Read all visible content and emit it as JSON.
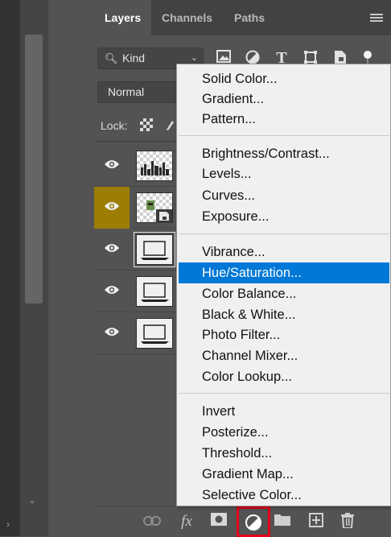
{
  "tabs": [
    {
      "label": "Layers",
      "active": true
    },
    {
      "label": "Channels",
      "active": false
    },
    {
      "label": "Paths",
      "active": false
    }
  ],
  "filter": {
    "kind_label": "Kind"
  },
  "blend_mode": "Normal",
  "lock_label": "Lock:",
  "layers": [
    {
      "thumb": "city-silhouette",
      "visible": true,
      "highlighted": false
    },
    {
      "thumb": "smart-object-image",
      "visible": true,
      "highlighted": true
    },
    {
      "thumb": "laptop-image",
      "visible": true,
      "highlighted": false,
      "selected": true
    },
    {
      "thumb": "laptop-image",
      "visible": true,
      "highlighted": false
    },
    {
      "thumb": "laptop-image",
      "visible": true,
      "highlighted": false
    }
  ],
  "adjustment_menu": {
    "groups": [
      [
        "Solid Color...",
        "Gradient...",
        "Pattern..."
      ],
      [
        "Brightness/Contrast...",
        "Levels...",
        "Curves...",
        "Exposure..."
      ],
      [
        "Vibrance...",
        "Hue/Saturation...",
        "Color Balance...",
        "Black & White...",
        "Photo Filter...",
        "Channel Mixer...",
        "Color Lookup..."
      ],
      [
        "Invert",
        "Posterize...",
        "Threshold...",
        "Gradient Map...",
        "Selective Color..."
      ]
    ],
    "items": {
      "solid_color": "Solid Color...",
      "gradient": "Gradient...",
      "pattern": "Pattern...",
      "brightness_contrast": "Brightness/Contrast...",
      "levels": "Levels...",
      "curves": "Curves...",
      "exposure": "Exposure...",
      "vibrance": "Vibrance...",
      "hue_saturation": "Hue/Saturation...",
      "color_balance": "Color Balance...",
      "black_white": "Black & White...",
      "photo_filter": "Photo Filter...",
      "channel_mixer": "Channel Mixer...",
      "color_lookup": "Color Lookup...",
      "invert": "Invert",
      "posterize": "Posterize...",
      "threshold": "Threshold...",
      "gradient_map": "Gradient Map...",
      "selective_color": "Selective Color..."
    },
    "highlighted_item": "Hue/Saturation..."
  },
  "bottom_icons": [
    "link-layers-icon",
    "fx-icon",
    "layer-mask-icon",
    "adjustment-layer-icon",
    "group-folder-icon",
    "new-layer-icon",
    "trash-icon"
  ],
  "bottom_fx_label": "fx",
  "colors": {
    "highlight_layer": "#9c7e05",
    "menu_selected": "#0078d7",
    "callout_border": "#e2001a"
  }
}
